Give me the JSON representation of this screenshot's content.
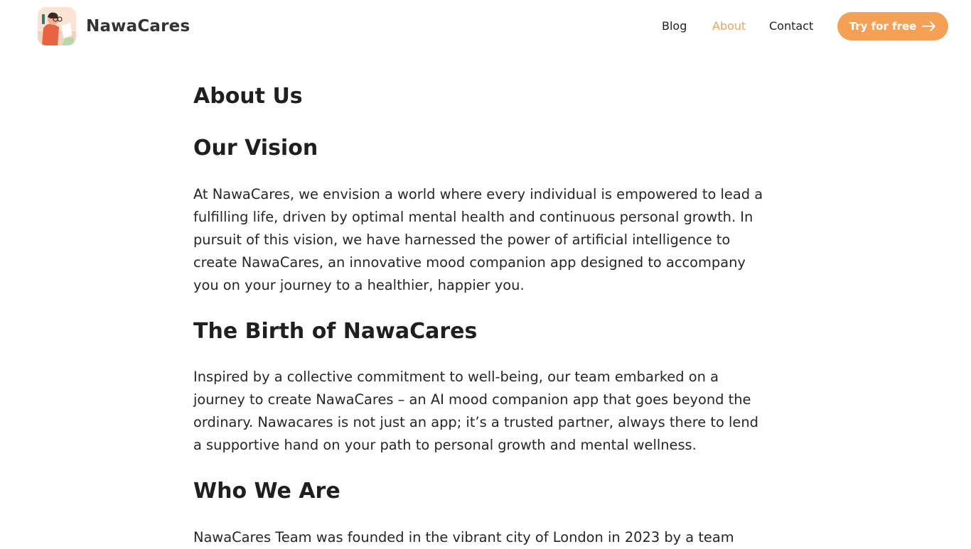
{
  "header": {
    "brand_name": "NawaCares",
    "nav": [
      {
        "label": "Blog",
        "active": false
      },
      {
        "label": "About",
        "active": true
      },
      {
        "label": "Contact",
        "active": false
      }
    ],
    "cta_label": "Try for free",
    "cta_icon": "arrow-right-icon",
    "accent_color": "#f4a155",
    "active_nav_color": "#f0a15a"
  },
  "article": {
    "title": "About Us",
    "sections": [
      {
        "heading": "Our Vision",
        "body": "At NawaCares, we envision a world where every individual is empowered to lead a fulfilling life, driven by optimal mental health and continuous personal growth. In pursuit of this vision, we have harnessed the power of artificial intelligence to create NawaCares, an innovative mood companion app designed to accompany you on your journey to a healthier, happier you."
      },
      {
        "heading": "The Birth of NawaCares",
        "body": "Inspired by a collective commitment to well-being, our team embarked on a journey to create NawaCares – an AI mood companion app that goes beyond the ordinary. Nawacares is not just an app; it’s a trusted partner, always there to lend a supportive hand on your path to personal growth and mental wellness."
      },
      {
        "heading": "Who We Are",
        "body": "NawaCares Team was founded in the vibrant city of London in 2023 by a team"
      }
    ]
  }
}
